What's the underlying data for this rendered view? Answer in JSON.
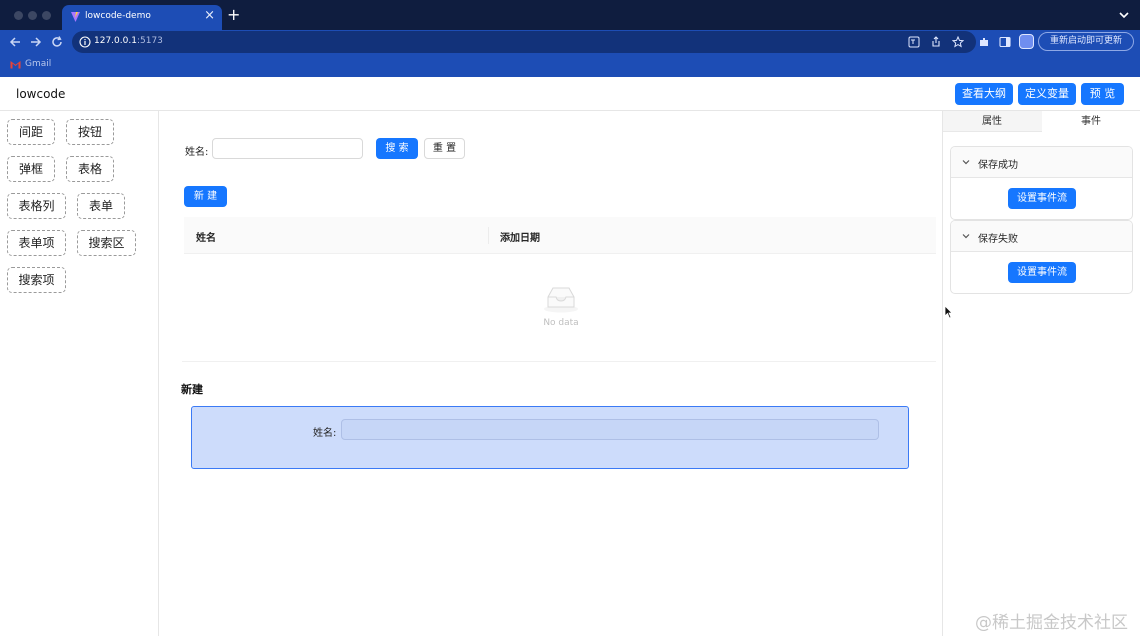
{
  "browser": {
    "tab_title": "lowcode-demo",
    "new_tab_symbol": "+",
    "close_symbol": "×",
    "url_host": "127.0.0.1",
    "url_port": ":5173",
    "update_label": "重新启动即可更新",
    "bookmark_label": "Gmail"
  },
  "header": {
    "logo": "lowcode",
    "buttons": [
      "查看大纲",
      "定义变量",
      "预 览"
    ]
  },
  "components": [
    "间距",
    "按钮",
    "弹框",
    "表格",
    "表格列",
    "表单",
    "表单项",
    "搜索区",
    "搜索项"
  ],
  "canvas": {
    "search_label": "姓名:",
    "search_button": "搜 索",
    "reset_button": "重 置",
    "new_button": "新 建",
    "table_headers": [
      "姓名",
      "添加日期"
    ],
    "empty_text": "No data",
    "section_title": "新建",
    "form_label": "姓名:"
  },
  "right_panel": {
    "tabs": [
      "属性",
      "事件"
    ],
    "active_tab": "事件",
    "events": [
      {
        "title": "保存成功",
        "button": "设置事件流"
      },
      {
        "title": "保存失败",
        "button": "设置事件流"
      }
    ]
  },
  "watermark": "@稀土掘金技术社区",
  "colors": {
    "primary": "#1677ff",
    "chrome_dark": "#0f1d3f",
    "chrome_blue": "#1d4db5",
    "selection_fill": "#cddcfb",
    "selection_border": "#3b7af5"
  }
}
